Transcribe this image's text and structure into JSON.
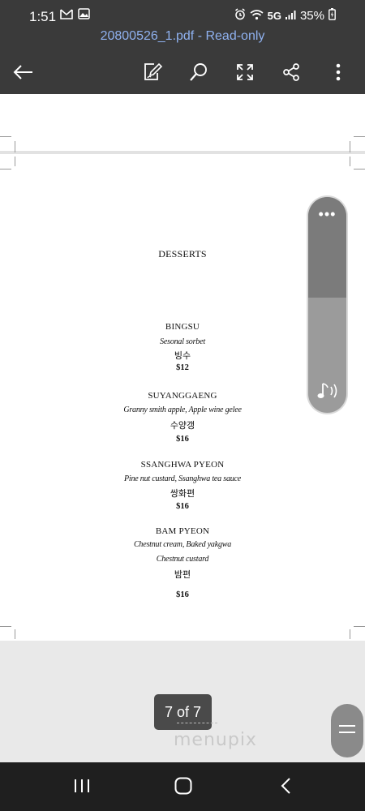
{
  "status_bar": {
    "time": "1:51",
    "network": "5G",
    "battery": "35%",
    "icons": [
      "gmail-icon",
      "gallery-icon",
      "alarm-icon",
      "wifi-icon",
      "signal-icon",
      "battery-icon"
    ]
  },
  "app_bar": {
    "document_title": "20800526_1.pdf - Read-only",
    "actions": [
      "back-icon",
      "edit-icon",
      "search-icon",
      "fullscreen-icon",
      "share-icon",
      "more-icon"
    ]
  },
  "menu": {
    "title": "DESSERTS",
    "items": [
      {
        "name": "BINGSU",
        "desc": [
          "Sesonal sorbet"
        ],
        "korean": "빙수",
        "price": "$12"
      },
      {
        "name": "SUYANGGAENG",
        "desc": [
          "Granny smith apple, Apple wine gelee"
        ],
        "korean": "수양갱",
        "price": "$16"
      },
      {
        "name": "SSANGHWA PYEON",
        "desc": [
          "Pine nut custard, Ssanghwa tea sauce"
        ],
        "korean": "쌍화편",
        "price": "$16"
      },
      {
        "name": "BAM PYEON",
        "desc": [
          "Chestnut cream, Baked yakgwa",
          "Chestnut custard"
        ],
        "korean": "밤편",
        "price": "$16"
      }
    ]
  },
  "scroller": {
    "more_glyph": "•••",
    "icon": "audio-icon"
  },
  "page_indicator": "7 of 7",
  "watermark": "menupix",
  "nav_bar": {
    "buttons": [
      "recents-icon",
      "home-icon",
      "back-nav-icon"
    ]
  },
  "colors": {
    "top_bar": "#3a3a3a",
    "title_link": "#8fb1ef",
    "nav_bar": "#1f1f1f"
  }
}
